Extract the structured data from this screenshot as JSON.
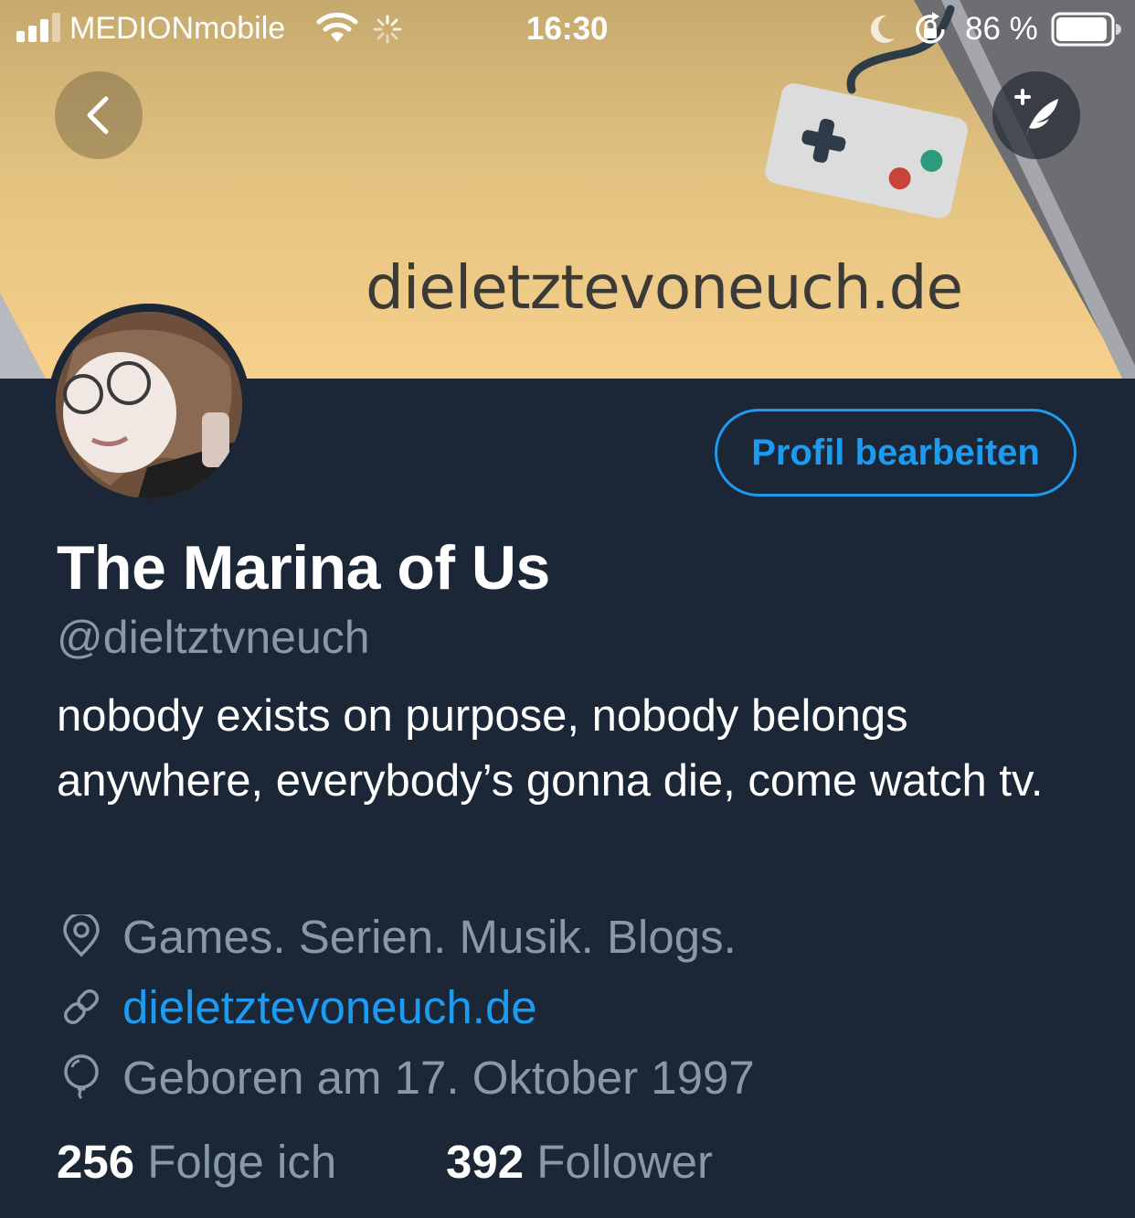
{
  "status_bar": {
    "carrier": "MEDIONmobile",
    "time": "16:30",
    "battery": "86 %",
    "icons": [
      "signal-icon",
      "wifi-icon",
      "activity-icon",
      "moon-icon",
      "rotation-lock-icon",
      "battery-icon"
    ]
  },
  "banner": {
    "site_text": "dieletztevoneuch.de"
  },
  "actions": {
    "edit_profile": "Profil bearbeiten"
  },
  "profile": {
    "name": "The Marina of Us",
    "handle": "@dieltztvneuch",
    "bio": "nobody exists on purpose, nobody belongs anywhere, everybody’s gonna die, come watch tv.",
    "location": "Games. Serien. Musik. Blogs.",
    "website": "dieletztevoneuch.de",
    "birthday": "Geboren am 17. Oktober 1997"
  },
  "stats": {
    "following_count": "256",
    "following_label": "Folge ich",
    "followers_count": "392",
    "followers_label": "Follower"
  },
  "colors": {
    "background": "#1b2636",
    "accent": "#1d9bf0",
    "secondary_text": "#8899a6",
    "banner": "#f7d08c"
  }
}
